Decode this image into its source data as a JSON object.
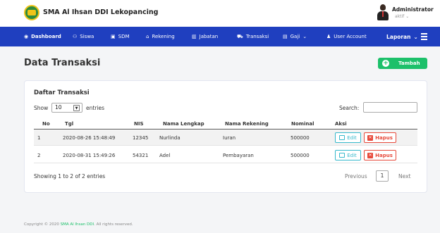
{
  "header": {
    "brand": "SMA Al Ihsan DDI Lekopancing",
    "user_name": "Administrator",
    "user_status": "aktif"
  },
  "nav": {
    "items": [
      {
        "label": "Dashboard",
        "icon": "gauge-icon"
      },
      {
        "label": "Siswa",
        "icon": "users-icon"
      },
      {
        "label": "SDM",
        "icon": "id-card-icon"
      },
      {
        "label": "Rekening",
        "icon": "bank-icon"
      },
      {
        "label": "Jabatan",
        "icon": "chart-icon"
      },
      {
        "label": "Transaksi",
        "icon": "cart-icon"
      },
      {
        "label": "Gaji",
        "icon": "wallet-icon"
      },
      {
        "label": "User Account",
        "icon": "user-icon"
      }
    ],
    "laporan": "Laporan"
  },
  "page": {
    "title": "Data Transaksi",
    "add_button": "Tambah"
  },
  "card": {
    "title": "Daftar Transaksi",
    "show_label": "Show",
    "show_value": "10",
    "entries_label": "entries",
    "search_label": "Search:"
  },
  "table": {
    "columns": [
      "No",
      "Tgl",
      "NIS",
      "Nama Lengkap",
      "Nama Rekening",
      "Nominal",
      "Aksi"
    ],
    "rows": [
      {
        "no": "1",
        "tgl": "2020-08-26 15:48:49",
        "nis": "12345",
        "nama": "Nurlinda",
        "rekening": "Iuran",
        "nominal": "500000"
      },
      {
        "no": "2",
        "tgl": "2020-08-31 15:49:26",
        "nis": "54321",
        "nama": "Adel",
        "rekening": "Pembayaran",
        "nominal": "500000"
      }
    ],
    "edit_label": "Edit",
    "delete_label": "Hapus"
  },
  "pagination": {
    "info": "Showing 1 to 2 of 2 entries",
    "previous": "Previous",
    "current": "1",
    "next": "Next"
  },
  "footer": {
    "prefix": "Copyright © 2020",
    "brand": "SMA Al Ihsan DDI",
    "suffix": ". All rights reserved."
  },
  "colors": {
    "nav_bg": "#1f3fbf",
    "accent_green": "#1cc06a",
    "edit_color": "#36b9cc",
    "delete_color": "#e74a3b"
  }
}
